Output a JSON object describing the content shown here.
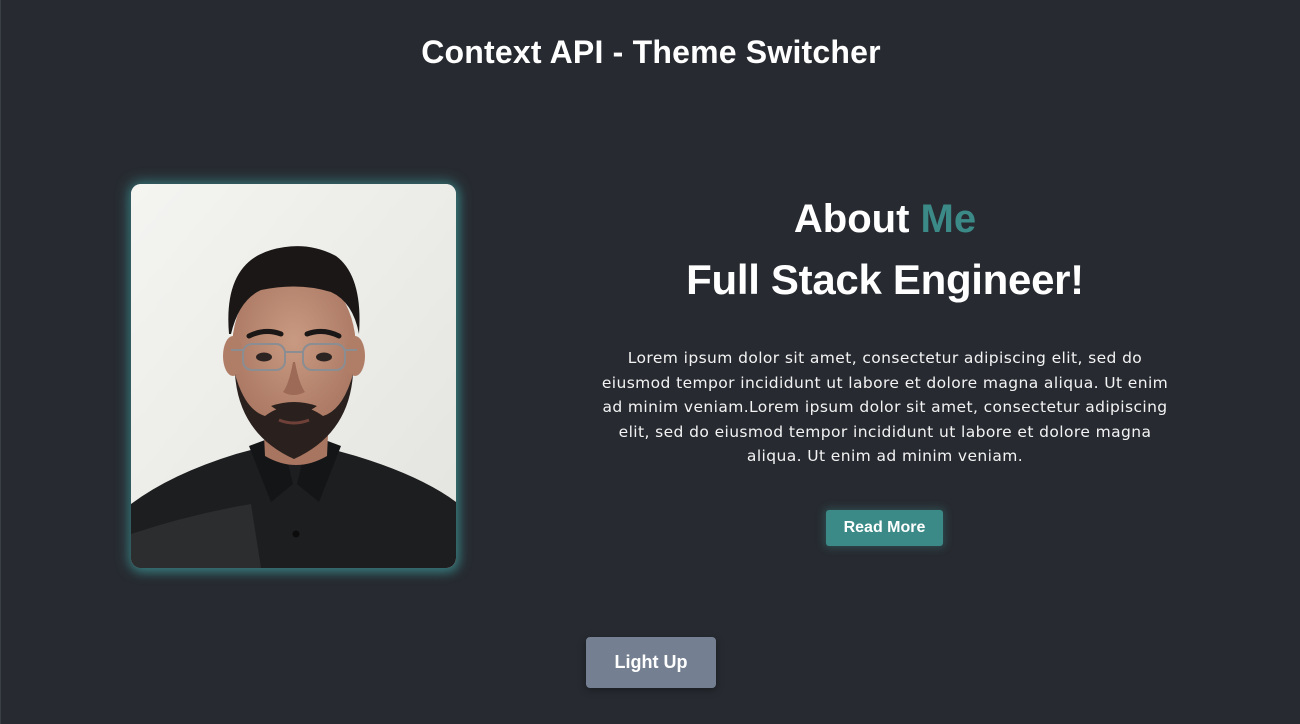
{
  "header": {
    "title": "Context API - Theme Switcher"
  },
  "profile": {
    "photo_icon": "portrait-photo"
  },
  "about": {
    "heading_prefix": "About",
    "heading_accent": "Me",
    "role": "Full Stack Engineer!",
    "bio": "Lorem ipsum dolor sit amet, consectetur adipiscing elit, sed do eiusmod tempor incididunt ut labore et dolore magna aliqua. Ut enim ad minim veniam.Lorem ipsum dolor sit amet, consectetur adipiscing elit, sed do eiusmod tempor incididunt ut labore et dolore magna aliqua. Ut enim ad minim veniam.",
    "read_more_label": "Read More"
  },
  "theme_toggle": {
    "label": "Light Up"
  },
  "colors": {
    "background": "#272b31",
    "accent": "#3b8a88",
    "toggle_button": "#748091",
    "text": "#ffffff"
  }
}
